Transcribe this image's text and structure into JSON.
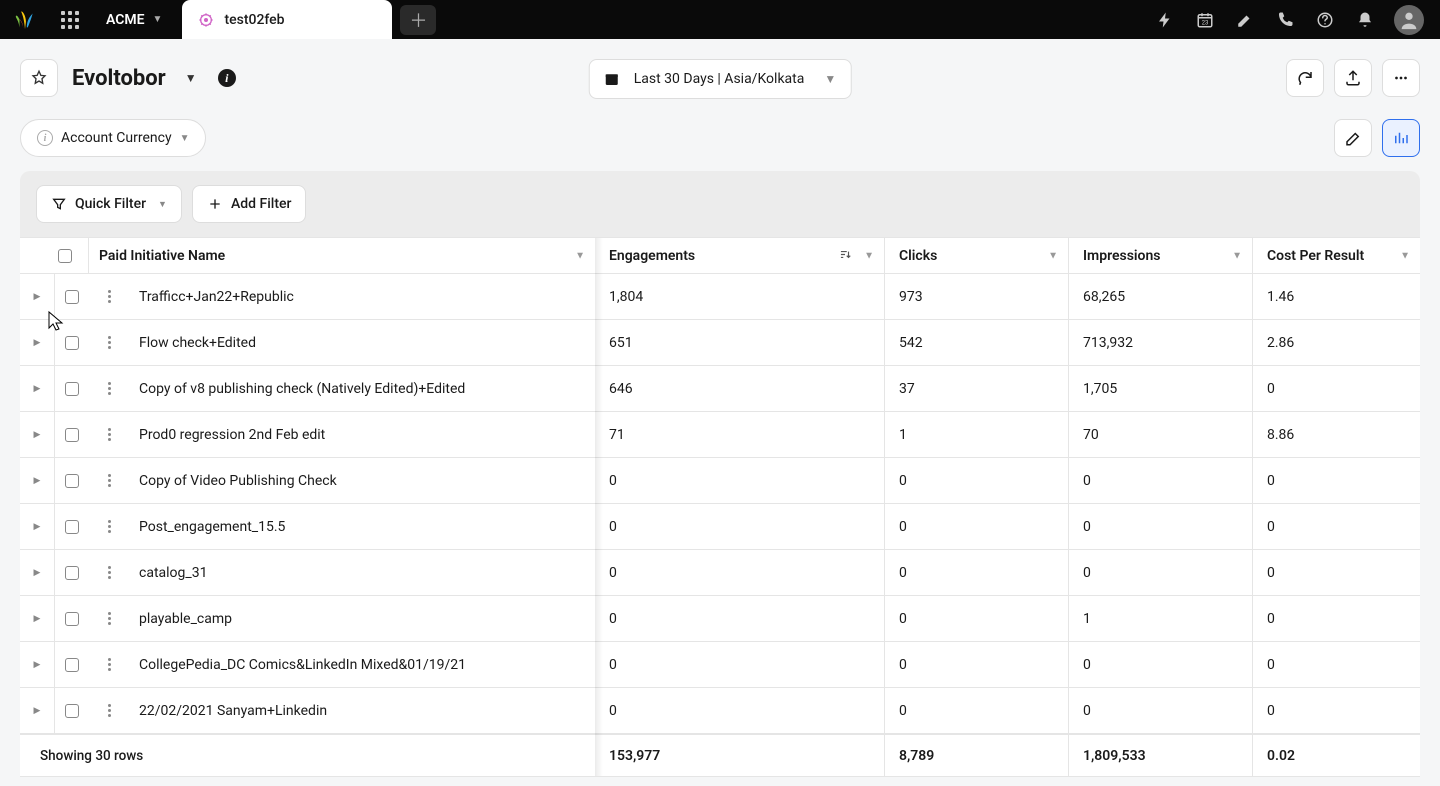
{
  "topbar": {
    "workspace": "ACME",
    "tab_label": "test02feb"
  },
  "header": {
    "title": "Evoltobor",
    "date_range": "Last 30 Days | Asia/Kolkata"
  },
  "subbar": {
    "currency_label": "Account Currency"
  },
  "filters": {
    "quick_filter": "Quick Filter",
    "add_filter": "Add Filter"
  },
  "table": {
    "headers": {
      "name": "Paid Initiative Name",
      "engagements": "Engagements",
      "clicks": "Clicks",
      "impressions": "Impressions",
      "cost": "Cost Per Result"
    },
    "rows": [
      {
        "name": "Trafficc+Jan22+Republic",
        "engagements": "1,804",
        "clicks": "973",
        "impressions": "68,265",
        "cost": "1.46"
      },
      {
        "name": "Flow check+Edited",
        "engagements": "651",
        "clicks": "542",
        "impressions": "713,932",
        "cost": "2.86"
      },
      {
        "name": "Copy of v8 publishing check (Natively Edited)+Edited",
        "engagements": "646",
        "clicks": "37",
        "impressions": "1,705",
        "cost": "0"
      },
      {
        "name": "Prod0 regression 2nd Feb edit",
        "engagements": "71",
        "clicks": "1",
        "impressions": "70",
        "cost": "8.86"
      },
      {
        "name": "Copy of Video Publishing Check",
        "engagements": "0",
        "clicks": "0",
        "impressions": "0",
        "cost": "0"
      },
      {
        "name": "Post_engagement_15.5",
        "engagements": "0",
        "clicks": "0",
        "impressions": "0",
        "cost": "0"
      },
      {
        "name": "catalog_31",
        "engagements": "0",
        "clicks": "0",
        "impressions": "0",
        "cost": "0"
      },
      {
        "name": "playable_camp",
        "engagements": "0",
        "clicks": "0",
        "impressions": "1",
        "cost": "0"
      },
      {
        "name": "CollegePedia_DC Comics&LinkedIn Mixed&01/19/21",
        "engagements": "0",
        "clicks": "0",
        "impressions": "0",
        "cost": "0"
      },
      {
        "name": "22/02/2021 Sanyam+Linkedin",
        "engagements": "0",
        "clicks": "0",
        "impressions": "0",
        "cost": "0"
      }
    ],
    "footer": {
      "summary": "Showing 30 rows",
      "engagements": "153,977",
      "clicks": "8,789",
      "impressions": "1,809,533",
      "cost": "0.02"
    }
  }
}
